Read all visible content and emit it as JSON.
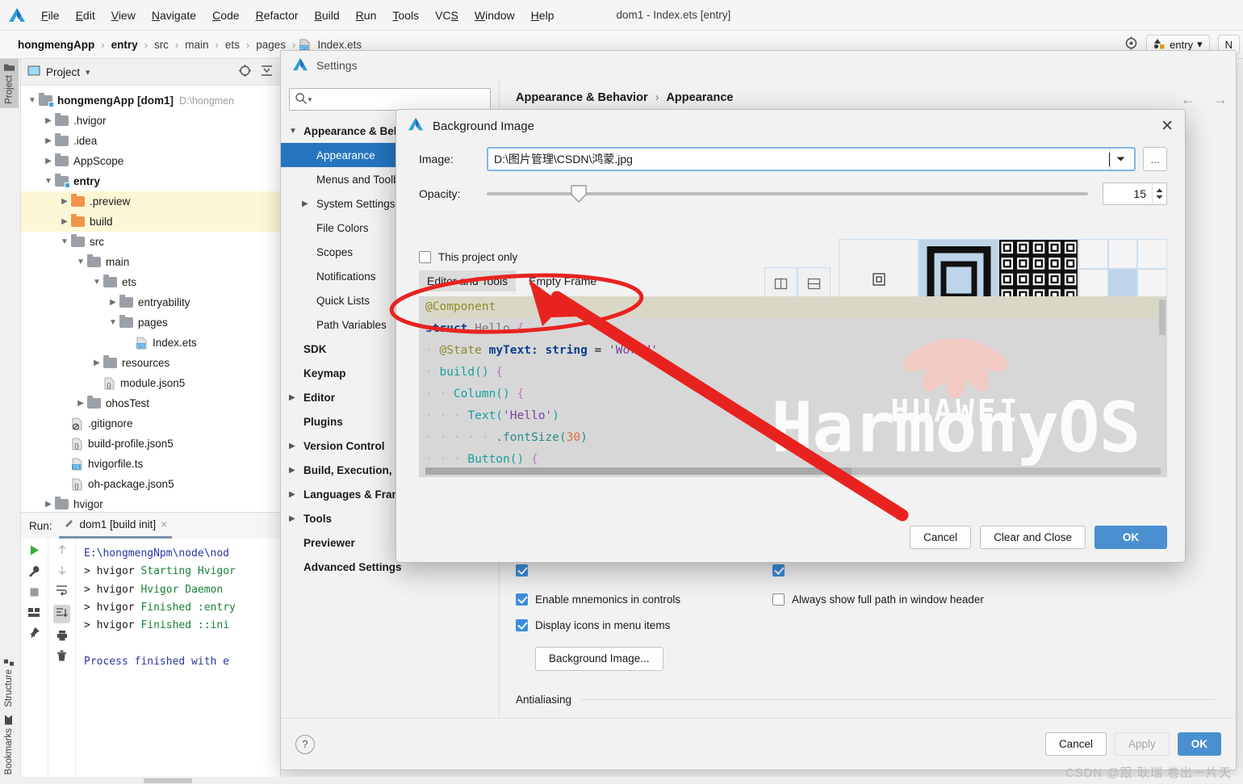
{
  "app": {
    "window_title": "dom1 - Index.ets [entry]",
    "logo_icon": "deveco-logo-icon"
  },
  "menubar": {
    "items": [
      {
        "label": "File",
        "mnemonic": "F"
      },
      {
        "label": "Edit",
        "mnemonic": "E"
      },
      {
        "label": "View",
        "mnemonic": "V"
      },
      {
        "label": "Navigate",
        "mnemonic": "N"
      },
      {
        "label": "Code",
        "mnemonic": "C"
      },
      {
        "label": "Refactor",
        "mnemonic": "R"
      },
      {
        "label": "Build",
        "mnemonic": "B"
      },
      {
        "label": "Run",
        "mnemonic": "R"
      },
      {
        "label": "Tools",
        "mnemonic": "T"
      },
      {
        "label": "VCS",
        "mnemonic": "S"
      },
      {
        "label": "Window",
        "mnemonic": "W"
      },
      {
        "label": "Help",
        "mnemonic": "H"
      }
    ]
  },
  "breadcrumb": {
    "items": [
      "hongmengApp",
      "entry",
      "src",
      "main",
      "ets",
      "pages",
      "Index.ets"
    ],
    "separator": "›",
    "file_icon": "ets-file-icon",
    "right": {
      "target_icon": "target-icon",
      "run_config": "entry",
      "run_config_icon": "module-icon",
      "chevron": "▾",
      "extra": "N"
    }
  },
  "vertical_tabs": {
    "top": [
      {
        "label": "Project",
        "icon": "folder-icon",
        "active": true
      }
    ],
    "bottom": [
      {
        "label": "Bookmarks",
        "icon": "bookmark-icon"
      },
      {
        "label": "Structure",
        "icon": "structure-icon"
      }
    ]
  },
  "project_panel": {
    "title": "Project",
    "title_icon": "project-icon",
    "chevron": "▾",
    "actions": [
      "locate-icon",
      "collapse-all-icon"
    ],
    "tree": [
      {
        "depth": 0,
        "arrow": "expanded",
        "icon": "module-folder",
        "label": "hongmengApp [dom1]",
        "bold": true,
        "path": "D:\\hongmen",
        "highlight": false
      },
      {
        "depth": 1,
        "arrow": "collapsed",
        "icon": "folder-gray",
        "label": ".hvigor",
        "highlight": false
      },
      {
        "depth": 1,
        "arrow": "collapsed",
        "icon": "folder-gray",
        "label": ".idea",
        "highlight": false
      },
      {
        "depth": 1,
        "arrow": "collapsed",
        "icon": "folder-gray",
        "label": "AppScope",
        "highlight": false
      },
      {
        "depth": 1,
        "arrow": "expanded",
        "icon": "module-folder",
        "label": "entry",
        "bold": true,
        "highlight": false
      },
      {
        "depth": 2,
        "arrow": "collapsed",
        "icon": "folder-orange",
        "label": ".preview",
        "highlight": true
      },
      {
        "depth": 2,
        "arrow": "collapsed",
        "icon": "folder-orange",
        "label": "build",
        "highlight": true
      },
      {
        "depth": 2,
        "arrow": "expanded",
        "icon": "folder-gray",
        "label": "src",
        "highlight": false
      },
      {
        "depth": 3,
        "arrow": "expanded",
        "icon": "folder-gray",
        "label": "main",
        "highlight": false
      },
      {
        "depth": 4,
        "arrow": "expanded",
        "icon": "folder-gray",
        "label": "ets",
        "highlight": false
      },
      {
        "depth": 5,
        "arrow": "collapsed",
        "icon": "folder-gray",
        "label": "entryability",
        "highlight": false
      },
      {
        "depth": 5,
        "arrow": "expanded",
        "icon": "folder-gray",
        "label": "pages",
        "highlight": false
      },
      {
        "depth": 6,
        "arrow": "none",
        "icon": "ets-file-icon",
        "label": "Index.ets",
        "highlight": false
      },
      {
        "depth": 4,
        "arrow": "collapsed",
        "icon": "folder-gray",
        "label": "resources",
        "highlight": false
      },
      {
        "depth": 4,
        "arrow": "none",
        "icon": "json5-file-icon",
        "label": "module.json5",
        "highlight": false
      },
      {
        "depth": 3,
        "arrow": "collapsed",
        "icon": "folder-gray",
        "label": "ohosTest",
        "highlight": false
      },
      {
        "depth": 2,
        "arrow": "none",
        "icon": "gitignore-file-icon",
        "label": ".gitignore",
        "highlight": false
      },
      {
        "depth": 2,
        "arrow": "none",
        "icon": "json5-file-icon",
        "label": "build-profile.json5",
        "highlight": false
      },
      {
        "depth": 2,
        "arrow": "none",
        "icon": "ts-file-icon",
        "label": "hvigorfile.ts",
        "highlight": false
      },
      {
        "depth": 2,
        "arrow": "none",
        "icon": "json5-file-icon",
        "label": "oh-package.json5",
        "highlight": false
      },
      {
        "depth": 1,
        "arrow": "collapsed",
        "icon": "folder-gray",
        "label": "hvigor",
        "highlight": false
      }
    ]
  },
  "run_panel": {
    "label": "Run:",
    "tab_title": "dom1 [build init]",
    "tab_icon": "hammer-icon",
    "tab_close": "×",
    "toolbar_left": [
      "run-icon",
      "wrench-icon",
      "stop-icon",
      "layout-icon",
      "pin-icon"
    ],
    "toolbar_right": [
      "up-arrow-icon",
      "down-arrow-icon",
      "soft-wrap-icon",
      "scroll-to-end-icon",
      "print-icon",
      "trash-icon"
    ],
    "console_lines": [
      {
        "text": "E:\\hongmengNpm\\node\\nod",
        "color": "blue"
      },
      {
        "prefix": "> hvigor ",
        "text": "Starting Hvigor",
        "color": "green"
      },
      {
        "prefix": "> hvigor ",
        "text": "Hvigor Daemon",
        "color": "green"
      },
      {
        "prefix": "> hvigor ",
        "text": "Finished :entry",
        "color": "green"
      },
      {
        "prefix": "> hvigor ",
        "text": "Finished ::ini",
        "color": "green"
      },
      {
        "text": "",
        "color": "blue"
      },
      {
        "text": "Process finished with e",
        "color": "blue"
      }
    ]
  },
  "settings_dialog": {
    "title": "Settings",
    "title_icon": "deveco-logo-icon",
    "search": {
      "placeholder": "",
      "icon": "search-icon"
    },
    "nav": [
      {
        "label": "Appearance & Behavior",
        "level": 0,
        "arrow": "expanded",
        "bold": true
      },
      {
        "label": "Appearance",
        "level": 1,
        "arrow": "none",
        "selected": true
      },
      {
        "label": "Menus and Toolbars",
        "level": 1,
        "arrow": "none"
      },
      {
        "label": "System Settings",
        "level": 1,
        "arrow": "collapsed"
      },
      {
        "label": "File Colors",
        "level": 1,
        "arrow": "none"
      },
      {
        "label": "Scopes",
        "level": 1,
        "arrow": "none"
      },
      {
        "label": "Notifications",
        "level": 1,
        "arrow": "none"
      },
      {
        "label": "Quick Lists",
        "level": 1,
        "arrow": "none"
      },
      {
        "label": "Path Variables",
        "level": 1,
        "arrow": "none"
      },
      {
        "label": "SDK",
        "level": 0,
        "arrow": "none",
        "bold": true
      },
      {
        "label": "Keymap",
        "level": 0,
        "arrow": "none",
        "bold": true
      },
      {
        "label": "Editor",
        "level": 0,
        "arrow": "collapsed",
        "bold": true
      },
      {
        "label": "Plugins",
        "level": 0,
        "arrow": "none",
        "bold": true
      },
      {
        "label": "Version Control",
        "level": 0,
        "arrow": "collapsed",
        "bold": true
      },
      {
        "label": "Build, Execution, Deployment",
        "level": 0,
        "arrow": "collapsed",
        "bold": true
      },
      {
        "label": "Languages & Frameworks",
        "level": 0,
        "arrow": "collapsed",
        "bold": true
      },
      {
        "label": "Tools",
        "level": 0,
        "arrow": "collapsed",
        "bold": true
      },
      {
        "label": "Previewer",
        "level": 0,
        "arrow": "none",
        "bold": true
      },
      {
        "label": "Advanced Settings",
        "level": 0,
        "arrow": "none",
        "bold": true
      }
    ],
    "breadcrumb": {
      "parent": "Appearance & Behavior",
      "separator": "›",
      "current": "Appearance"
    },
    "nav_arrows": {
      "back": "←",
      "forward": "→"
    },
    "checkboxes": [
      {
        "label": "Enable mnemonics in controls",
        "checked": true,
        "column": "left"
      },
      {
        "label": "Display icons in menu items",
        "checked": true,
        "column": "left"
      },
      {
        "label": "Always show full path in window header",
        "checked": false,
        "column": "right"
      }
    ],
    "background_image_button": "Background Image...",
    "antialiasing_section": "Antialiasing",
    "footer": {
      "help": "?",
      "cancel": "Cancel",
      "apply": "Apply",
      "ok": "OK"
    }
  },
  "background_dialog": {
    "title": "Background Image",
    "title_icon": "deveco-logo-icon",
    "close_icon": "close-icon",
    "image_label": "Image:",
    "image_value": "D:\\图片管理\\CSDN\\鸿蒙.jpg",
    "image_dropdown_icon": "chevron-down-icon",
    "browse_button": "...",
    "opacity_label": "Opacity:",
    "opacity_value": "15",
    "opacity_percent": 15,
    "anchor_icons": [
      "split-vertical-icon",
      "split-horizontal-icon"
    ],
    "fill_modes": [
      {
        "name": "plain-mode",
        "selected": false
      },
      {
        "name": "scale-mode",
        "selected": true
      },
      {
        "name": "tile-mode",
        "selected": false
      }
    ],
    "position_grid": {
      "selected_cell": "center"
    },
    "this_project_only": {
      "label": "This project only",
      "checked": false
    },
    "target_tabs": [
      {
        "label": "Editor and Tools",
        "active": true
      },
      {
        "label": "Empty Frame",
        "active": false
      }
    ],
    "preview_code": [
      {
        "indent": 0,
        "tokens": [
          {
            "t": "@Component",
            "c": "ann"
          }
        ]
      },
      {
        "indent": 0,
        "tokens": [
          {
            "t": "struct",
            "c": "kw"
          },
          {
            "t": " ",
            "c": "dots"
          },
          {
            "t": "Hello",
            "c": "type"
          },
          {
            "t": " ",
            "c": "dots"
          },
          {
            "t": "{",
            "c": "brace"
          }
        ]
      },
      {
        "indent": 1,
        "tokens": [
          {
            "t": "@State",
            "c": "ann"
          },
          {
            "t": " ",
            "c": "plain"
          },
          {
            "t": "myText:",
            "c": "kwb"
          },
          {
            "t": " ",
            "c": "plain"
          },
          {
            "t": "string",
            "c": "kwb"
          },
          {
            "t": " = ",
            "c": "plain"
          },
          {
            "t": "'World'",
            "c": "str"
          }
        ]
      },
      {
        "indent": 1,
        "tokens": [
          {
            "t": "build()",
            "c": "fn"
          },
          {
            "t": " ",
            "c": "dots"
          },
          {
            "t": "{",
            "c": "brace"
          }
        ]
      },
      {
        "indent": 2,
        "tokens": [
          {
            "t": "Column()",
            "c": "fn"
          },
          {
            "t": " ",
            "c": "dots"
          },
          {
            "t": "{",
            "c": "brace"
          }
        ]
      },
      {
        "indent": 3,
        "tokens": [
          {
            "t": "Text(",
            "c": "fn"
          },
          {
            "t": "'Hello'",
            "c": "str"
          },
          {
            "t": ")",
            "c": "fn"
          }
        ]
      },
      {
        "indent": 5,
        "tokens": [
          {
            "t": ".fontSize(",
            "c": "prop"
          },
          {
            "t": "30",
            "c": "num"
          },
          {
            "t": ")",
            "c": "prop"
          }
        ]
      },
      {
        "indent": 3,
        "tokens": [
          {
            "t": "Button()",
            "c": "fn"
          },
          {
            "t": " ",
            "c": "dots"
          },
          {
            "t": "{",
            "c": "brace"
          }
        ]
      }
    ],
    "watermark": {
      "brand": "HUAWEI",
      "os": "HarmonyOS"
    },
    "buttons": {
      "cancel": "Cancel",
      "clear_and_close": "Clear and Close",
      "ok": "OK"
    }
  },
  "annotation": {
    "color": "#e8231f",
    "shape": "ellipse-with-arrow",
    "target": "Editor and Tools / Empty Frame tabs"
  },
  "watermark_credit": "CSDN @跟 耿瑞 卷出一片天",
  "colors": {
    "accent_blue": "#2675bf",
    "ok_button": "#4a90d0",
    "highlight_row": "#fdf7d5",
    "folder_orange": "#f0954a",
    "annotation_red": "#e8231f"
  }
}
